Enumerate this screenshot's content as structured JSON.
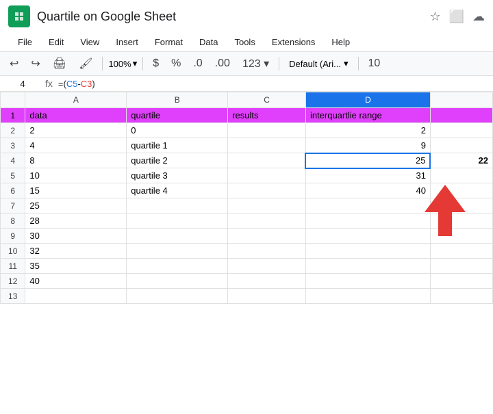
{
  "title": {
    "text": "Quartile on Google Sheet",
    "app_icon": "⊞"
  },
  "title_icons": [
    "☆",
    "⬜",
    "☁"
  ],
  "menu": {
    "items": [
      "File",
      "Edit",
      "View",
      "Insert",
      "Format",
      "Data",
      "Tools",
      "Extensions",
      "Help"
    ]
  },
  "toolbar": {
    "undo": "↩",
    "redo": "↪",
    "print": "🖶",
    "format_paint": "🖌",
    "zoom": "100%",
    "zoom_arrow": "▾",
    "dollar": "$",
    "percent": "%",
    "decimal_less": ".0",
    "decimal_more": ".00",
    "more_formats": "123",
    "font_name": "Default (Ari...",
    "font_arrow": "▾",
    "font_size": "10"
  },
  "formula_bar": {
    "cell_ref": "4",
    "fx": "fx",
    "formula": "=(C5-C3)"
  },
  "columns": {
    "headers": [
      "",
      "A",
      "B",
      "C",
      "D",
      ""
    ],
    "widths": [
      32,
      130,
      130,
      100,
      160,
      80
    ]
  },
  "rows": [
    {
      "num": "1",
      "cells": [
        "data",
        "quartile",
        "results",
        "interquartlie range",
        ""
      ]
    },
    {
      "num": "2",
      "cells": [
        "2",
        "0",
        "",
        "2",
        ""
      ]
    },
    {
      "num": "3",
      "cells": [
        "4",
        "quartile 1",
        "",
        "9",
        ""
      ]
    },
    {
      "num": "4",
      "cells": [
        "8",
        "quartile 2",
        "",
        "25",
        "22"
      ]
    },
    {
      "num": "5",
      "cells": [
        "10",
        "quartile 3",
        "",
        "31",
        ""
      ]
    },
    {
      "num": "6",
      "cells": [
        "15",
        "quartile 4",
        "",
        "40",
        ""
      ]
    },
    {
      "num": "7",
      "cells": [
        "25",
        "",
        "",
        "",
        ""
      ]
    },
    {
      "num": "8",
      "cells": [
        "28",
        "",
        "",
        "",
        ""
      ]
    },
    {
      "num": "9",
      "cells": [
        "30",
        "",
        "",
        "",
        ""
      ]
    },
    {
      "num": "10",
      "cells": [
        "32",
        "",
        "",
        "",
        ""
      ]
    },
    {
      "num": "11",
      "cells": [
        "35",
        "",
        "",
        "",
        ""
      ]
    },
    {
      "num": "12",
      "cells": [
        "40",
        "",
        "",
        "",
        ""
      ]
    },
    {
      "num": "13",
      "cells": [
        "",
        "",
        "",
        "",
        ""
      ]
    }
  ],
  "colors": {
    "header_bg": "#e040fb",
    "selected_border": "#1a73e8",
    "arrow_color": "#e53935",
    "app_green": "#0F9D58"
  }
}
